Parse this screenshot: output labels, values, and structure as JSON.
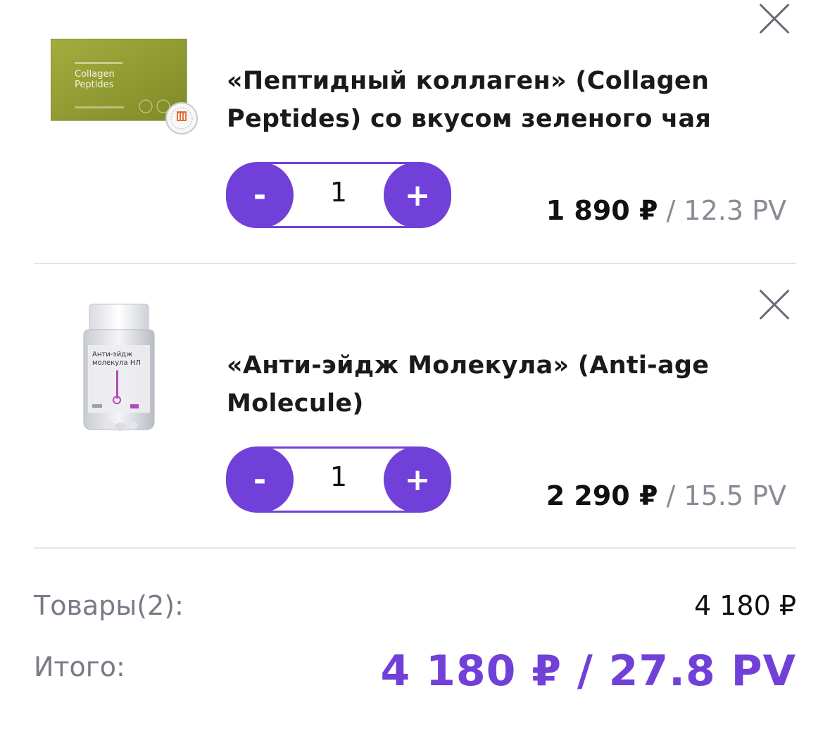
{
  "cart": {
    "items": [
      {
        "title_line1": "«Пептидный коллаген» (Collagen",
        "title_line2": "Peptides) со вкусом зеленого чая",
        "quantity": "1",
        "minus_label": "-",
        "plus_label": "+",
        "price": "1 890 ₽",
        "separator": " / ",
        "pv": "12.3 PV",
        "image_text_line1": "Collagen",
        "image_text_line2": "Peptides"
      },
      {
        "title_line1": "«Анти-эйдж Молекула» (Anti-age",
        "title_line2": "Molecule)",
        "quantity": "1",
        "minus_label": "-",
        "plus_label": "+",
        "price": "2 290 ₽",
        "separator": " / ",
        "pv": "15.5 PV",
        "image_text_line1": "Анти-эйдж",
        "image_text_line2": "молекула НЛ"
      }
    ]
  },
  "summary": {
    "goods_label": "Товары(2):",
    "goods_value": "4 180 ₽",
    "total_label": "Итого:",
    "total_value": "4 180 ₽ / 27.8 PV"
  },
  "colors": {
    "accent": "#7140d8",
    "muted_text": "#8a8a96",
    "divider": "#e3e3ea"
  },
  "icons": [
    "close-icon",
    "minus-icon",
    "plus-icon"
  ]
}
